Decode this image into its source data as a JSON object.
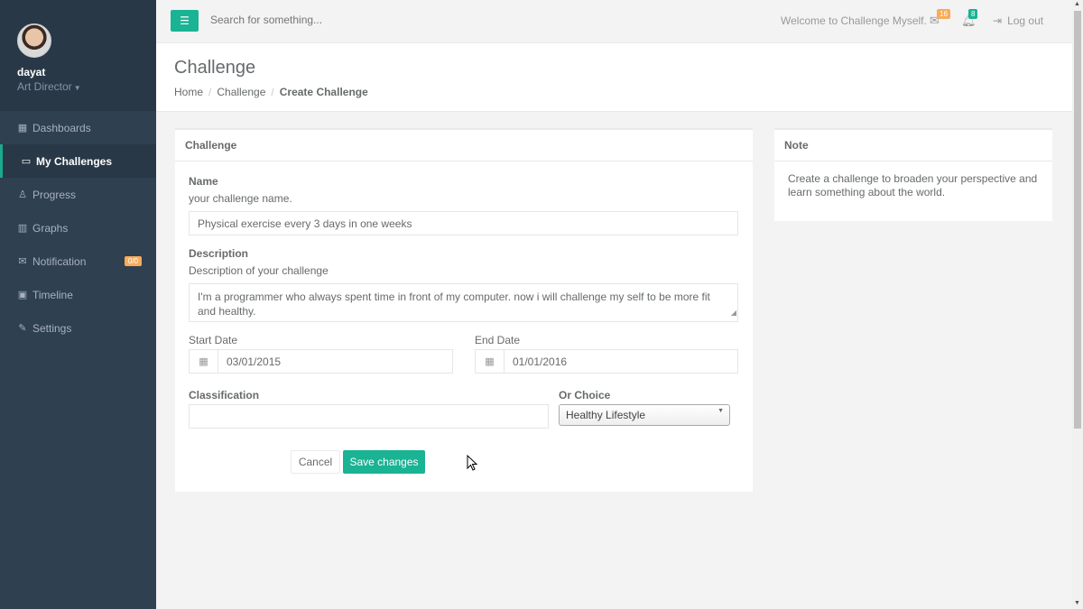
{
  "user": {
    "name": "dayat",
    "role": "Art Director"
  },
  "nav": [
    {
      "label": "Dashboards",
      "icon": "th-large-icon",
      "glyph": "▦"
    },
    {
      "label": "My Challenges",
      "icon": "desktop-icon",
      "glyph": "▭"
    },
    {
      "label": "Progress",
      "icon": "flask-icon",
      "glyph": "♙"
    },
    {
      "label": "Graphs",
      "icon": "bar-chart-icon",
      "glyph": "▥"
    },
    {
      "label": "Notification",
      "icon": "envelope-icon",
      "glyph": "✉",
      "badge": "0/0"
    },
    {
      "label": "Timeline",
      "icon": "picture-icon",
      "glyph": "▣"
    },
    {
      "label": "Settings",
      "icon": "magic-icon",
      "glyph": "✎"
    }
  ],
  "topbar": {
    "search_placeholder": "Search for something...",
    "welcome": "Welcome to Challenge Myself.",
    "messages_count": "16",
    "alerts_count": "8",
    "logout": "Log out"
  },
  "page": {
    "title": "Challenge",
    "breadcrumb": [
      "Home",
      "Challenge",
      "Create Challenge"
    ]
  },
  "form": {
    "panel_title": "Challenge",
    "name_label": "Name",
    "name_help": "your challenge name.",
    "name_value": "Physical exercise every 3 days in one weeks",
    "desc_label": "Description",
    "desc_help": "Description of your challenge",
    "desc_value": "I'm a programmer who always spent time in front of my computer. now i will challenge my self to be more fit and healthy.",
    "start_label": "Start Date",
    "start_value": "03/01/2015",
    "end_label": "End Date",
    "end_value": "01/01/2016",
    "class_label": "Classification",
    "class_value": "",
    "choice_label": "Or Choice",
    "choice_value": "Healthy Lifestyle",
    "cancel": "Cancel",
    "save": "Save changes"
  },
  "note": {
    "title": "Note",
    "text": "Create a challenge to broaden your perspective and learn something about the world."
  },
  "colors": {
    "accent": "#1ab394",
    "sidebar": "#2f4050",
    "badge_orange": "#f8ac59",
    "badge_green": "#1ab394"
  }
}
